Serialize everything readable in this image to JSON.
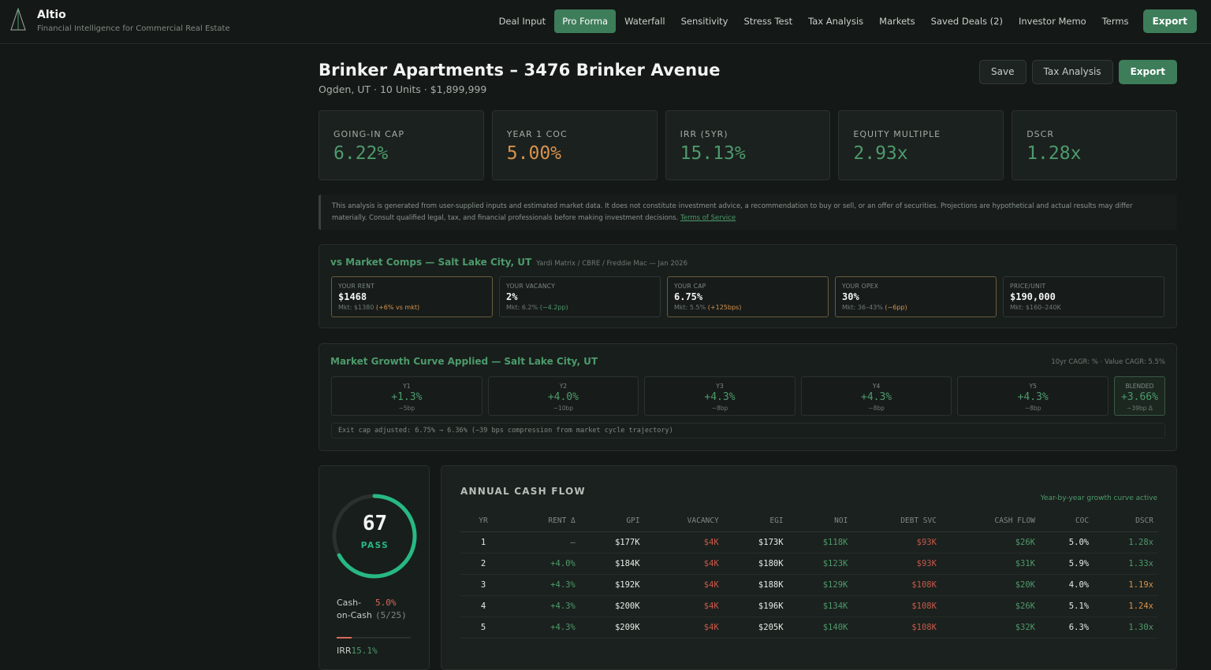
{
  "app": {
    "name": "Altio",
    "tagline": "Financial Intelligence for Commercial Real Estate"
  },
  "nav": {
    "items": [
      {
        "label": "Deal Input"
      },
      {
        "label": "Pro Forma",
        "active": true
      },
      {
        "label": "Waterfall"
      },
      {
        "label": "Sensitivity"
      },
      {
        "label": "Stress Test"
      },
      {
        "label": "Tax Analysis"
      },
      {
        "label": "Markets"
      },
      {
        "label": "Saved Deals (2)"
      },
      {
        "label": "Investor Memo"
      },
      {
        "label": "Terms"
      }
    ],
    "export_label": "Export"
  },
  "property": {
    "title": "Brinker Apartments – 3476 Brinker Avenue",
    "subtitle": "Ogden, UT · 10 Units · $1,899,999"
  },
  "actions": {
    "save": "Save",
    "tax": "Tax Analysis",
    "export": "Export"
  },
  "metrics": [
    {
      "label": "GOING-IN CAP",
      "value": "6.22%",
      "color": "green"
    },
    {
      "label": "YEAR 1 COC",
      "value": "5.00%",
      "color": "orange"
    },
    {
      "label": "IRR (5YR)",
      "value": "15.13%",
      "color": "green"
    },
    {
      "label": "EQUITY MULTIPLE",
      "value": "2.93x",
      "color": "green"
    },
    {
      "label": "DSCR",
      "value": "1.28x",
      "color": "green"
    }
  ],
  "disclaimer": {
    "text": "This analysis is generated from user-supplied inputs and estimated market data. It does not constitute investment advice, a recommendation to buy or sell, or an offer of securities. Projections are hypothetical and actual results may differ materially. Consult qualified legal, tax, and financial professionals before making investment decisions.",
    "link": "Terms of Service"
  },
  "comps": {
    "title": "vs Market Comps — Salt Lake City, UT",
    "source": "Yardi Matrix / CBRE / Freddie Mac — Jan 2026",
    "items": [
      {
        "label": "YOUR RENT",
        "value": "$1468",
        "mkt": "Mkt: $1380",
        "delta": "(+6% vs mkt)",
        "warn": true
      },
      {
        "label": "YOUR VACANCY",
        "value": "2%",
        "mkt": "Mkt: 6.2%",
        "delta": "(−4.2pp)",
        "good": true
      },
      {
        "label": "YOUR CAP",
        "value": "6.75%",
        "mkt": "Mkt: 5.5%",
        "delta": "(+125bps)",
        "warn": true
      },
      {
        "label": "YOUR OPEX",
        "value": "30%",
        "mkt": "Mkt: 36–43%",
        "delta": "(−6pp)",
        "warn": true
      },
      {
        "label": "PRICE/UNIT",
        "value": "$190,000",
        "mkt": "Mkt: $160–240K",
        "delta": ""
      }
    ]
  },
  "growth": {
    "title": "Market Growth Curve Applied — Salt Lake City, UT",
    "cagr": "10yr CAGR: % · Value CAGR: 5.5%",
    "years": [
      {
        "label": "Y1",
        "value": "+1.3%",
        "bp": "−5bp"
      },
      {
        "label": "Y2",
        "value": "+4.0%",
        "bp": "−10bp"
      },
      {
        "label": "Y3",
        "value": "+4.3%",
        "bp": "−8bp"
      },
      {
        "label": "Y4",
        "value": "+4.3%",
        "bp": "−8bp"
      },
      {
        "label": "Y5",
        "value": "+4.3%",
        "bp": "−8bp"
      }
    ],
    "blended": {
      "label": "BLENDED",
      "value": "+3.66%",
      "bp": "−39bp Δ"
    },
    "exit_note": "Exit cap adjusted: 6.75% → 6.36% (−39 bps compression from market cycle trajectory)"
  },
  "score": {
    "value": "67",
    "fraction": 0.67,
    "status": "PASS",
    "coc_name": "Cash-on-Cash",
    "coc_value": "5.0%",
    "coc_sub": "(5/25)",
    "coc_fraction": 0.2,
    "irr_name": "IRR",
    "irr_value": "15.1%",
    "colors": {
      "ring": "#27b884",
      "track": "#2a302d"
    }
  },
  "cashflow": {
    "title": "ANNUAL CASH FLOW",
    "note": "Year-by-year growth curve active",
    "headers": [
      "YR",
      "RENT Δ",
      "GPI",
      "VACANCY",
      "EGI",
      "NOI",
      "DEBT SVC",
      "CASH FLOW",
      "COC",
      "DSCR"
    ],
    "rows": [
      [
        "1",
        "—",
        "$177K",
        "$4K",
        "$173K",
        "$118K",
        "$93K",
        "$26K",
        "5.0%",
        "1.28x"
      ],
      [
        "2",
        "+4.0%",
        "$184K",
        "$4K",
        "$180K",
        "$123K",
        "$93K",
        "$31K",
        "5.9%",
        "1.33x"
      ],
      [
        "3",
        "+4.3%",
        "$192K",
        "$4K",
        "$188K",
        "$129K",
        "$108K",
        "$20K",
        "4.0%",
        "1.19x"
      ],
      [
        "4",
        "+4.3%",
        "$200K",
        "$4K",
        "$196K",
        "$134K",
        "$108K",
        "$26K",
        "5.1%",
        "1.24x"
      ],
      [
        "5",
        "+4.3%",
        "$209K",
        "$4K",
        "$205K",
        "$140K",
        "$108K",
        "$32K",
        "6.3%",
        "1.30x"
      ]
    ],
    "dscr_warn": [
      false,
      false,
      true,
      true,
      false
    ]
  }
}
